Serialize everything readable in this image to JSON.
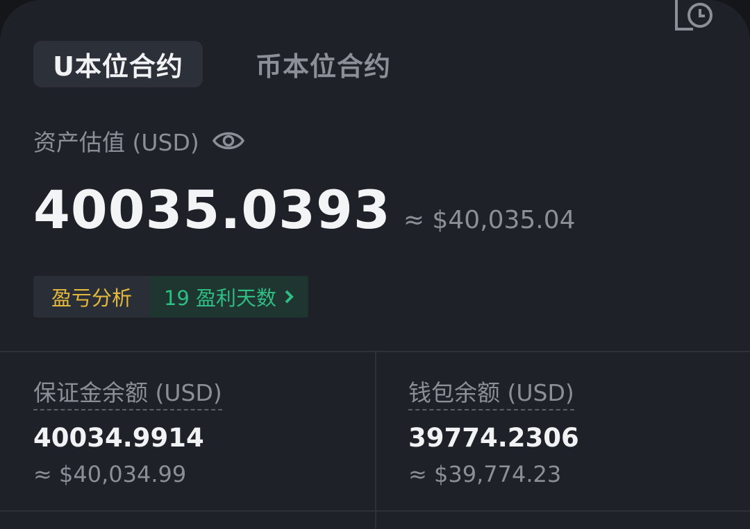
{
  "tabs": [
    {
      "label": "U本位合约",
      "active": true
    },
    {
      "label": "币本位合约",
      "active": false
    }
  ],
  "asset": {
    "label": "资产估值 (USD)",
    "value": "40035.0393",
    "approx": "≈ $40,035.04"
  },
  "pnl": {
    "label": "盈亏分析",
    "profit_days": "19 盈利天数"
  },
  "balances": [
    {
      "label": "保证金余额 (USD)",
      "value": "40034.9914",
      "approx": "≈ $40,034.99"
    },
    {
      "label": "钱包余额 (USD)",
      "value": "39774.2306",
      "approx": "≈ $39,774.23"
    }
  ],
  "icons": {
    "history": "history-clock-icon",
    "eye": "eye-icon",
    "chevron": "chevron-right-icon"
  },
  "colors": {
    "background": "#1e2128",
    "text_primary": "#f1f2f4",
    "text_secondary": "#8a8f98",
    "pnl_yellow": "#e4b83a",
    "profit_green": "#2dbd85"
  }
}
